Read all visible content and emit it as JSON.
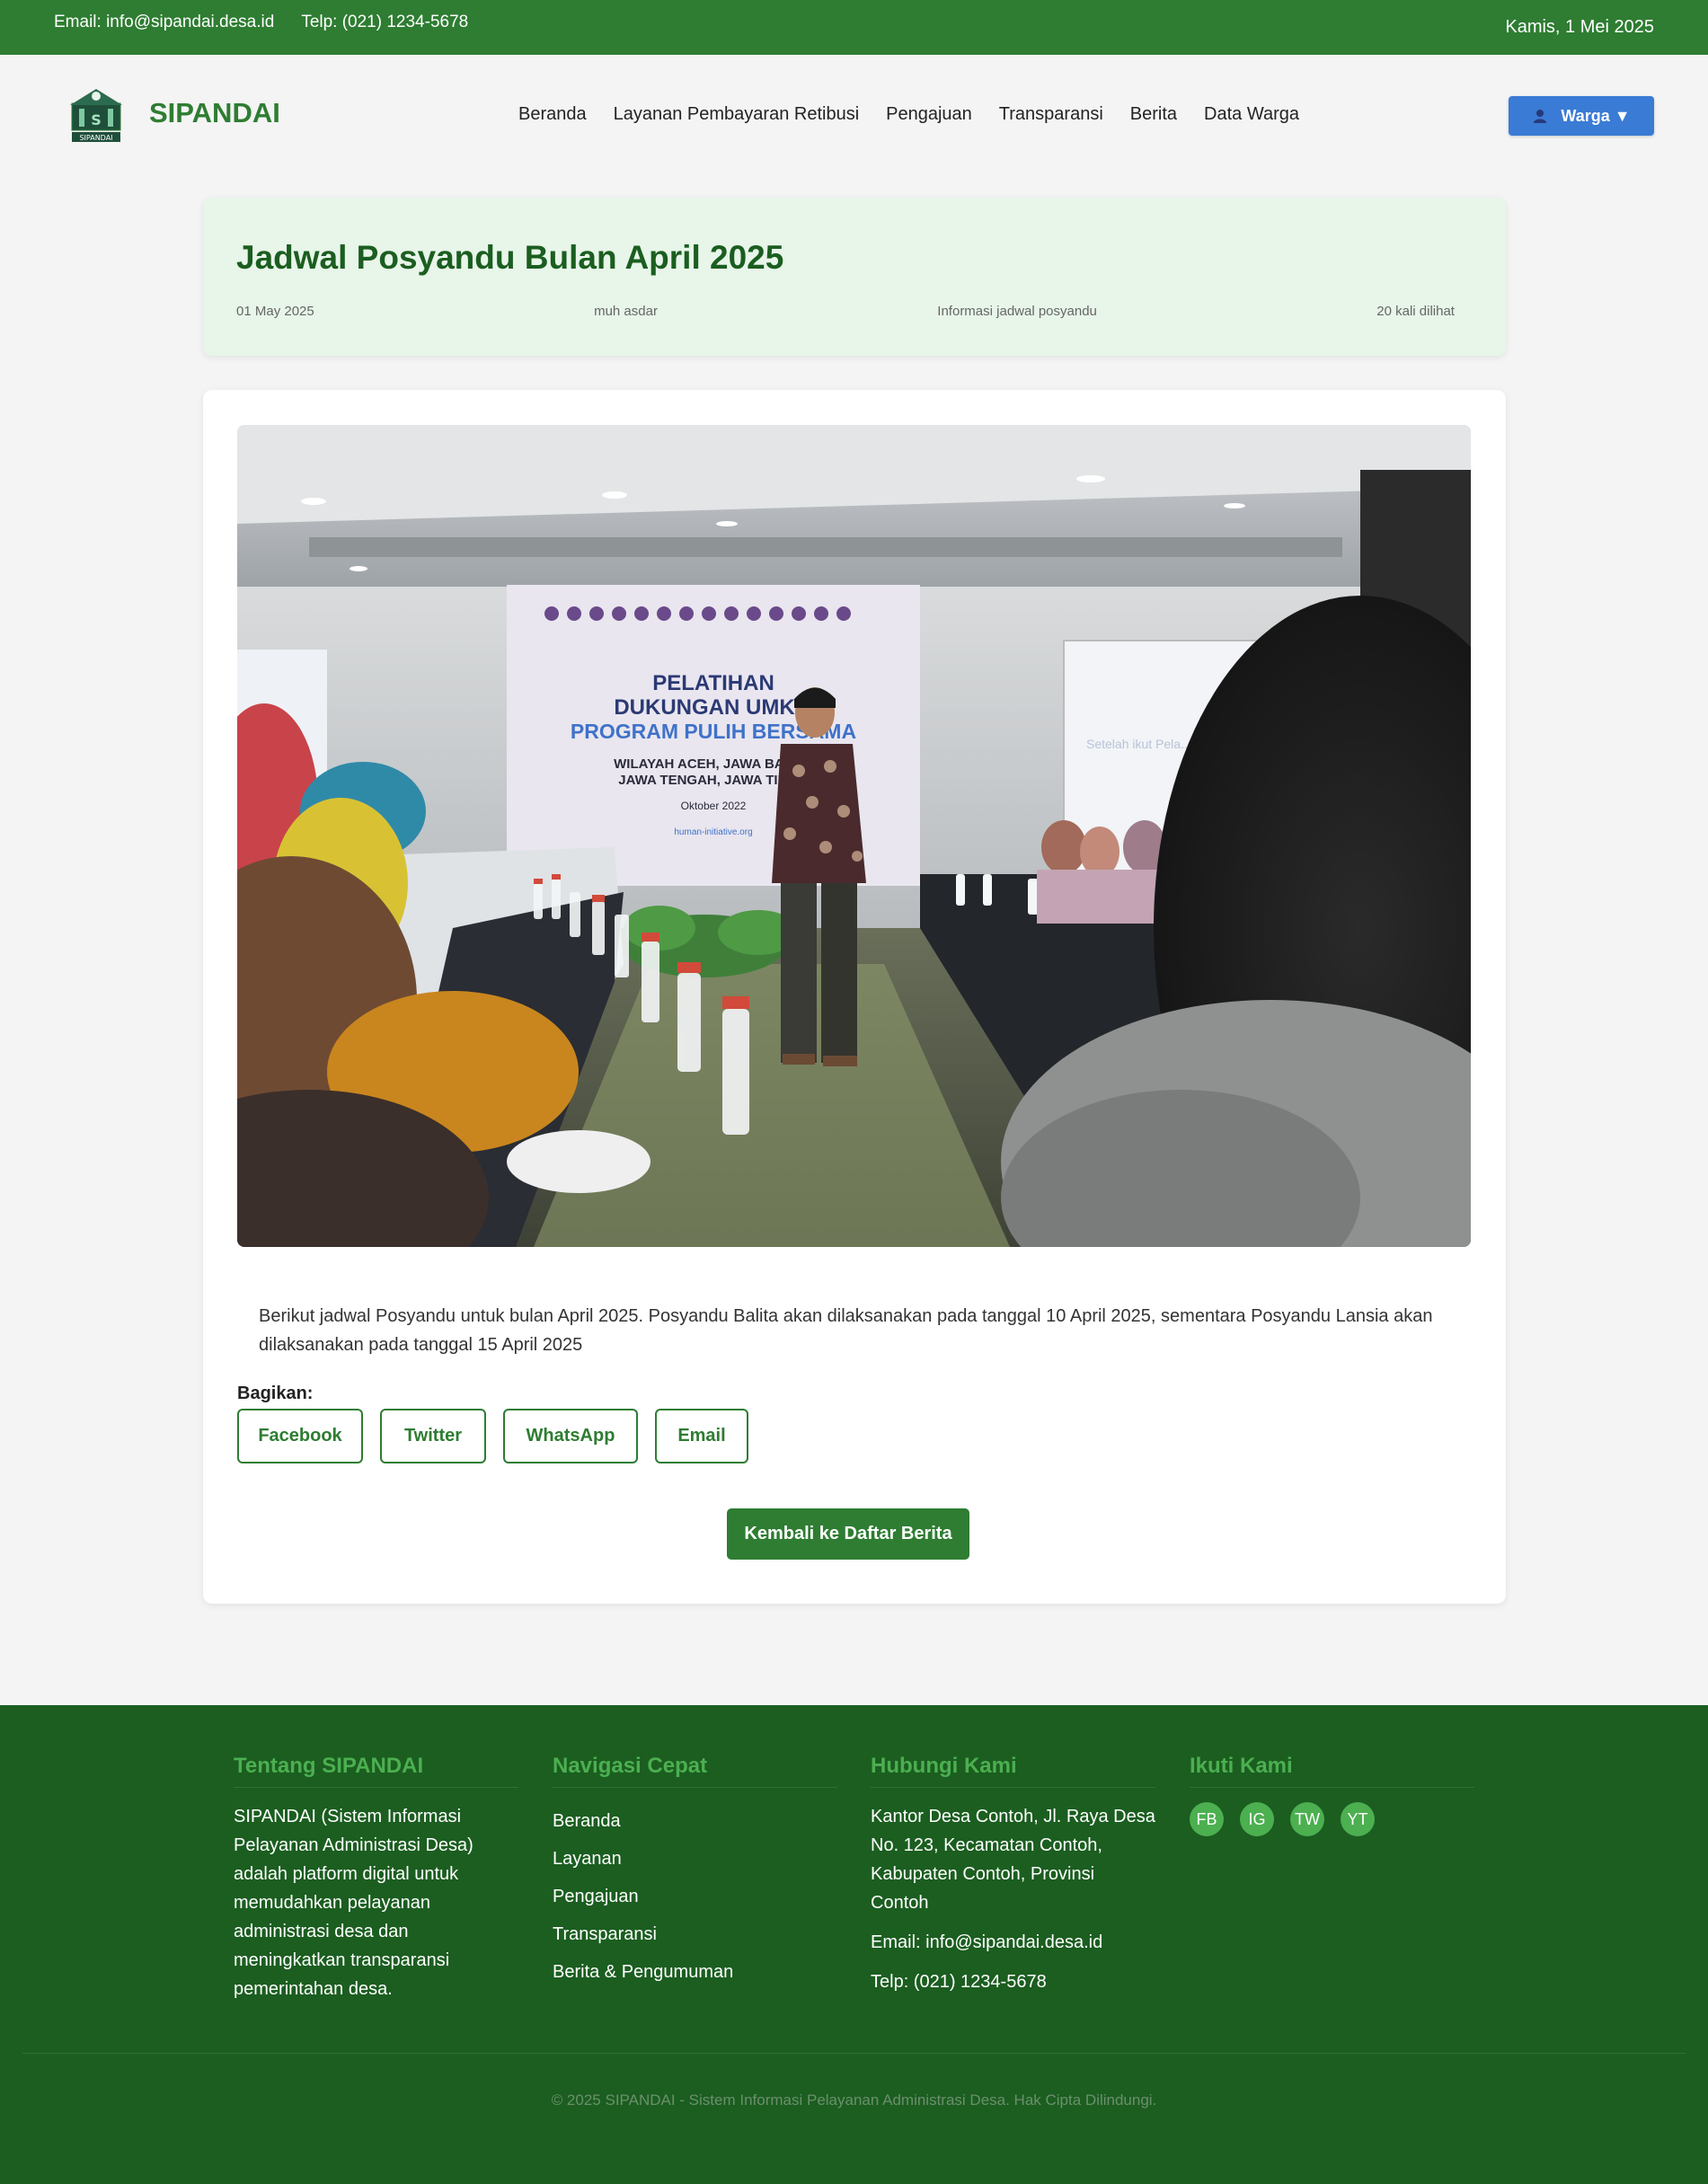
{
  "topbar": {
    "email": "Email: info@sipandai.desa.id",
    "phone": "Telp: (021) 1234-5678",
    "date": "Kamis, 1 Mei 2025"
  },
  "header": {
    "logo_text": "SIPANDAI",
    "brand": "SIPANDAI",
    "nav": [
      "Beranda",
      "Layanan Pembayaran Retibusi",
      "Pengajuan",
      "Transparansi",
      "Berita",
      "Data Warga"
    ],
    "user_button": "Warga ▼"
  },
  "article": {
    "title": "Jadwal Posyandu Bulan April 2025",
    "date": "01 May 2025",
    "author": "muh asdar",
    "category": "Informasi jadwal posyandu",
    "views": "20 kali dilihat",
    "image": {
      "banner_title_1": "PELATIHAN",
      "banner_title_2": "DUKUNGAN UMKM",
      "banner_title_3": "PROGRAM PULIH BERSAMA",
      "banner_sub_1": "WILAYAH ACEH, JAWA BARAT,",
      "banner_sub_2": "JAWA TENGAH, JAWA TIMUR",
      "banner_date": "Oktober 2022",
      "banner_url": "human-initiative.org",
      "screen_text": "Setelah ikut Pela... apa rencana Usa..."
    },
    "body": "Berikut jadwal Posyandu untuk bulan April 2025. Posyandu Balita akan dilaksanakan pada tanggal 10 April 2025, sementara Posyandu Lansia akan dilaksanakan pada tanggal 15 April 2025",
    "share_label": "Bagikan:",
    "share_buttons": [
      "Facebook",
      "Twitter",
      "WhatsApp",
      "Email"
    ],
    "back_button": "Kembali ke Daftar Berita"
  },
  "footer": {
    "about": {
      "heading": "Tentang SIPANDAI",
      "text": "SIPANDAI (Sistem Informasi Pelayanan Administrasi Desa) adalah platform digital untuk memudahkan pelayanan administrasi desa dan meningkatkan transparansi pemerintahan desa."
    },
    "quicknav": {
      "heading": "Navigasi Cepat",
      "links": [
        "Beranda",
        "Layanan",
        "Pengajuan",
        "Transparansi",
        "Berita & Pengumuman"
      ]
    },
    "contact": {
      "heading": "Hubungi Kami",
      "address": "Kantor Desa Contoh, Jl. Raya Desa No. 123, Kecamatan Contoh, Kabupaten Contoh, Provinsi Contoh",
      "email": "Email: info@sipandai.desa.id",
      "phone": "Telp: (021) 1234-5678"
    },
    "social": {
      "heading": "Ikuti Kami",
      "items": [
        "FB",
        "IG",
        "TW",
        "YT"
      ]
    },
    "copyright": "© 2025 SIPANDAI - Sistem Informasi Pelayanan Administrasi Desa. Hak Cipta Dilindungi."
  },
  "colors": {
    "primary": "#2e7d32",
    "footer_bg": "#1b5e20",
    "accent_green": "#4caf50",
    "user_button": "#3a7bd5"
  }
}
